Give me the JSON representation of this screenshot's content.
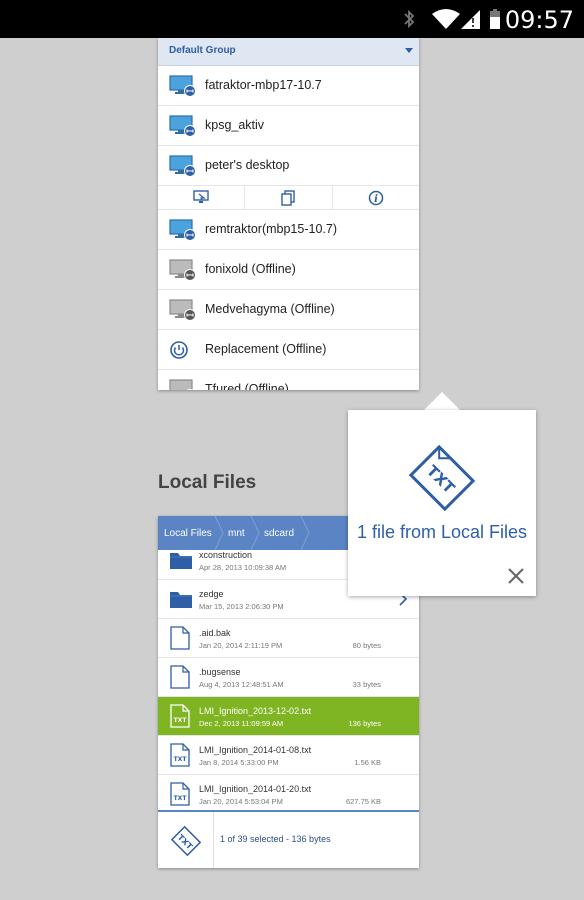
{
  "status_bar": {
    "time": "09:57"
  },
  "computers": {
    "group": "Default Group",
    "rows_top": [
      {
        "name": "fatraktor-mbp17-10.7",
        "state": "online"
      },
      {
        "name": "kpsg_aktiv",
        "state": "online"
      },
      {
        "name": "peter's desktop",
        "state": "online"
      }
    ],
    "actions": [
      "remote-control-icon",
      "copy-files-icon",
      "info-icon"
    ],
    "rows_bottom": [
      {
        "name": "remtraktor(mbp15-10.7)",
        "state": "online"
      },
      {
        "name": "fonixold (Offline)",
        "state": "offline"
      },
      {
        "name": "Medvehagyma (Offline)",
        "state": "offline"
      },
      {
        "name": "Replacement (Offline)",
        "state": "power"
      },
      {
        "name": "Tfured (Offline)",
        "state": "offline"
      }
    ]
  },
  "local_files": {
    "title": "Local Files",
    "breadcrumb": [
      "Local Files",
      "mnt",
      "sdcard"
    ],
    "files": [
      {
        "name": "xconstruction",
        "date": "Apr 28, 2013 10:09:38 AM",
        "size": "",
        "type": "folder"
      },
      {
        "name": "zedge",
        "date": "Mar 15, 2013 2:06:30 PM",
        "size": "",
        "type": "folder"
      },
      {
        "name": ".aid.bak",
        "date": "Jan 20, 2014 2:11:19 PM",
        "size": "80 bytes",
        "type": "file"
      },
      {
        "name": ".bugsense",
        "date": "Aug 4, 2013 12:48:51 AM",
        "size": "33 bytes",
        "type": "file"
      },
      {
        "name": "LMI_Ignition_2013-12-02.txt",
        "date": "Dec 2, 2013 11:09:59 AM",
        "size": "136 bytes",
        "type": "txt",
        "selected": true
      },
      {
        "name": "LMI_Ignition_2014-01-08.txt",
        "date": "Jan 8, 2014 5:33:00 PM",
        "size": "1.56 KB",
        "type": "txt"
      },
      {
        "name": "LMI_Ignition_2014-01-20.txt",
        "date": "Jan 20, 2014 5:53:04 PM",
        "size": "627.75 KB",
        "type": "txt"
      }
    ],
    "footer_text": "1 of 39 selected - 136 bytes"
  },
  "popup": {
    "text": "1 file from Local Files"
  },
  "colors": {
    "accent": "#2d5ea6",
    "breadcrumb": "#5a84c4",
    "selected": "#7fb522"
  }
}
